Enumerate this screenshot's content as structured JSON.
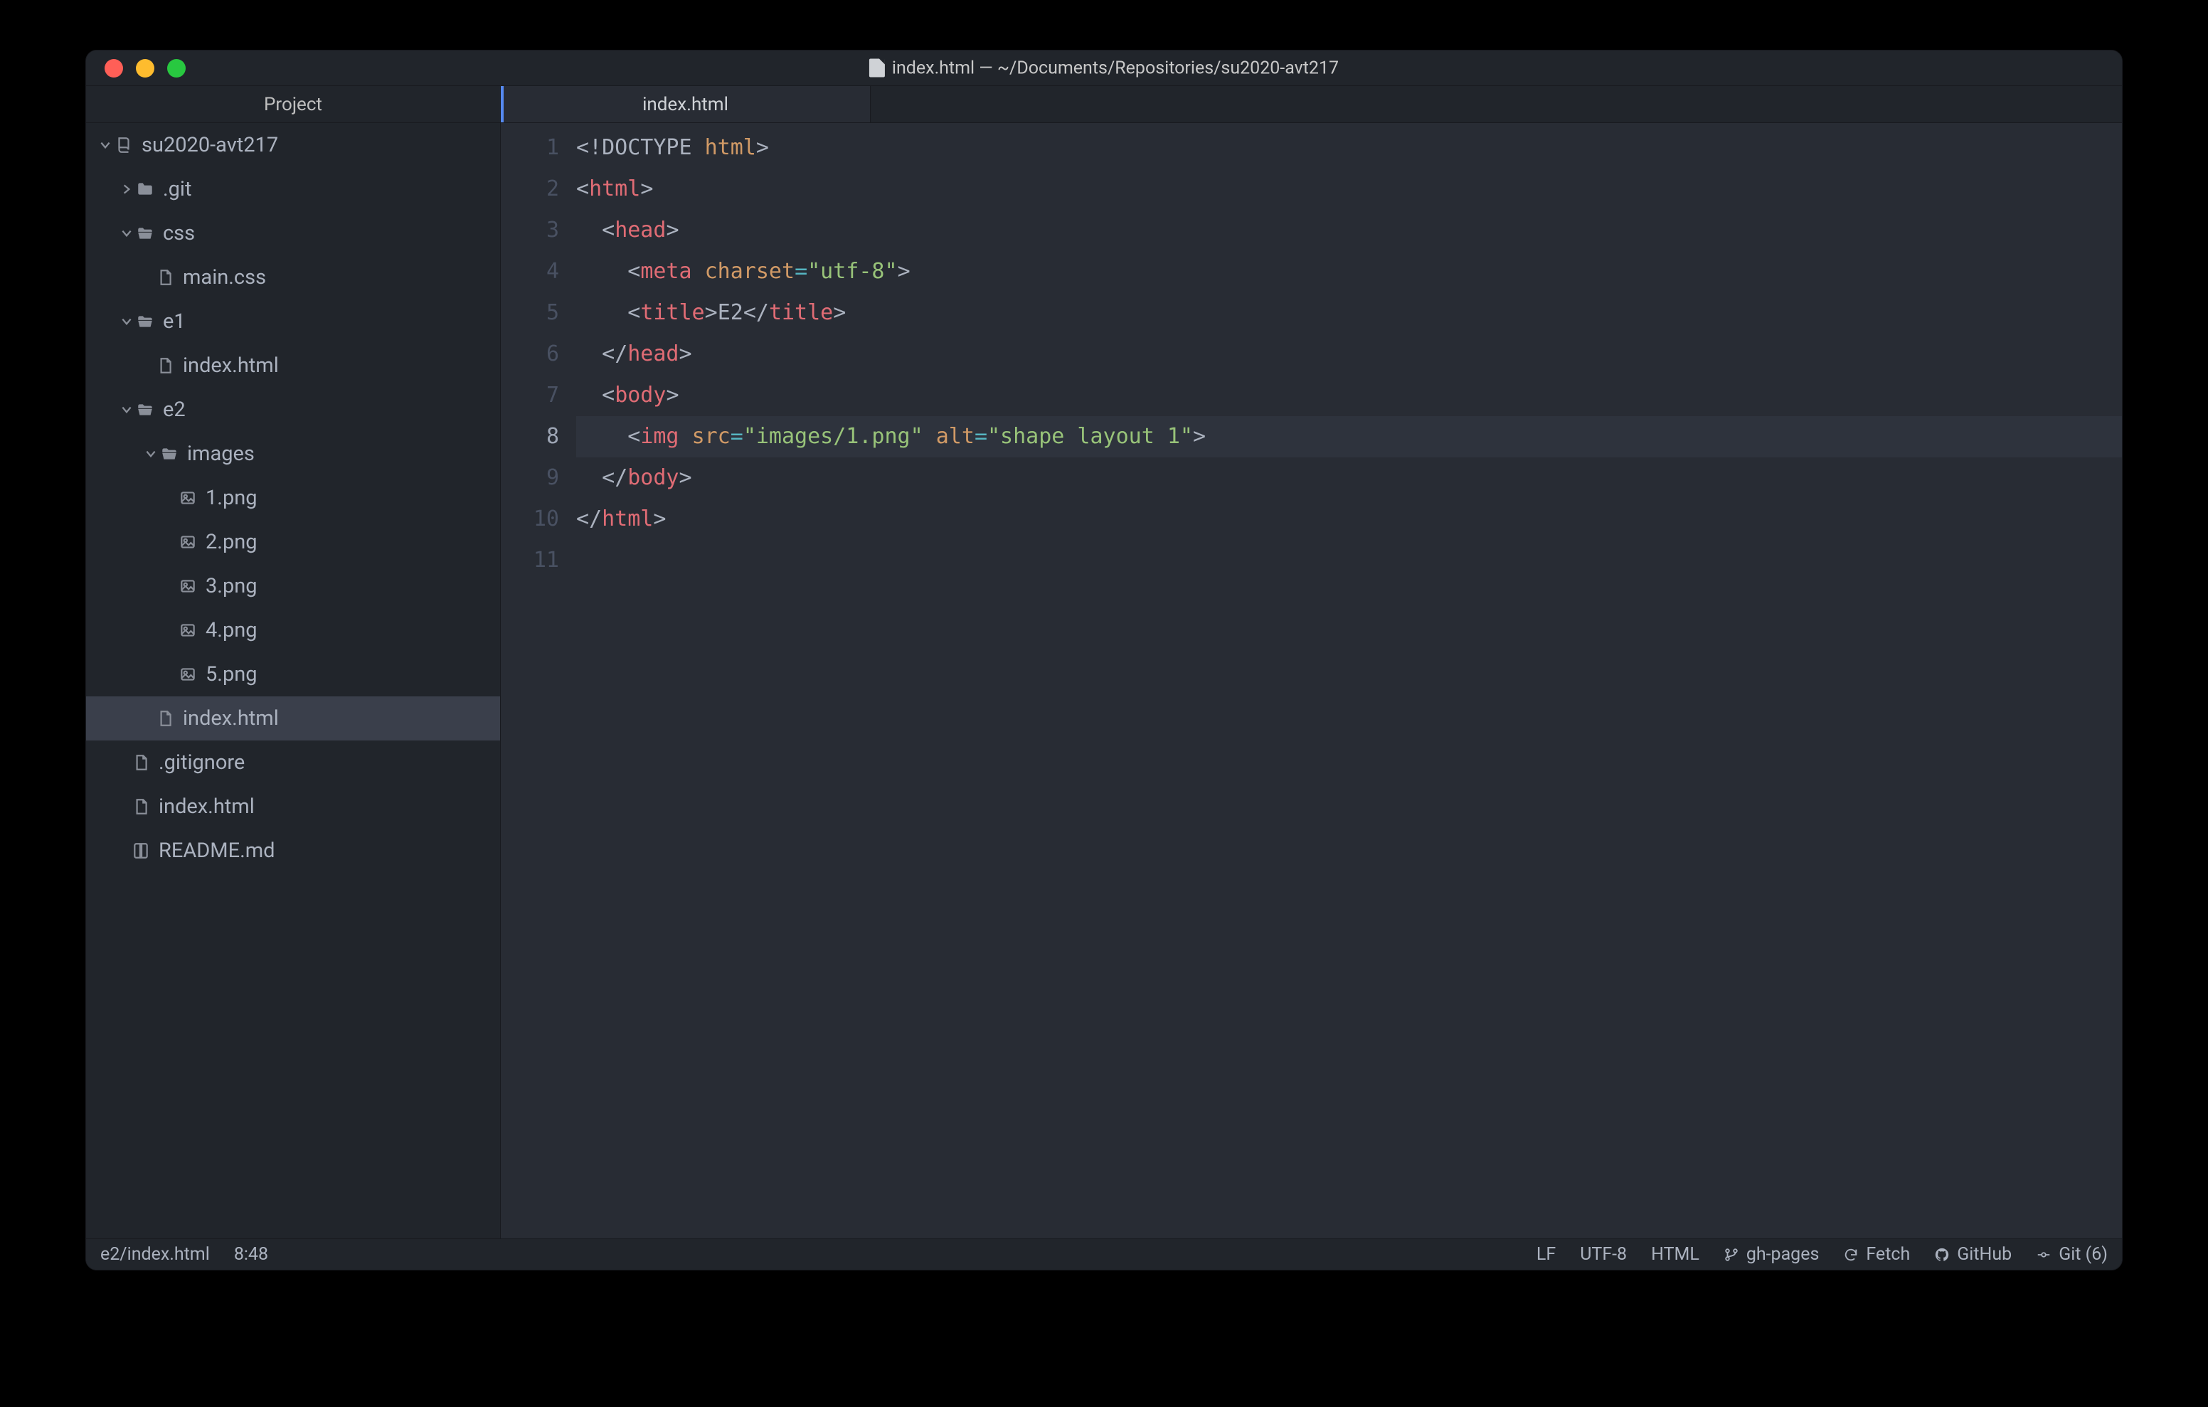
{
  "title": "index.html — ~/Documents/Repositories/su2020-avt217",
  "sidebar": {
    "tab": "Project",
    "root": "su2020-avt217",
    "items": {
      "git": ".git",
      "css": "css",
      "maincss": "main.css",
      "e1": "e1",
      "e1_index": "index.html",
      "e2": "e2",
      "images": "images",
      "img1": "1.png",
      "img2": "2.png",
      "img3": "3.png",
      "img4": "4.png",
      "img5": "5.png",
      "e2_index": "index.html",
      "gitignore": ".gitignore",
      "root_index": "index.html",
      "readme": "README.md"
    }
  },
  "tabs": {
    "active": "index.html"
  },
  "gutter": {
    "1": "1",
    "2": "2",
    "3": "3",
    "4": "4",
    "5": "5",
    "6": "6",
    "7": "7",
    "8": "8",
    "9": "9",
    "10": "10",
    "11": "11"
  },
  "code": {
    "doctype_open": "<!",
    "doctype": "DOCTYPE",
    "sp": " ",
    "attr_html": "html",
    "gt": ">",
    "lt": "<",
    "slash": "/",
    "tag_html": "html",
    "tag_head": "head",
    "tag_meta": "meta",
    "tag_title": "title",
    "tag_body": "body",
    "tag_img": "img",
    "attr_charset": "charset",
    "attr_src": "src",
    "attr_alt": "alt",
    "eq": "=",
    "val_charset": "\"utf-8\"",
    "val_src": "\"images/1.png\"",
    "val_alt": "\"shape layout 1\"",
    "title_text": "E2",
    "pad2": "  ",
    "pad4": "    ",
    "pad1": " "
  },
  "status": {
    "path": "e2/index.html",
    "cursor": "8:48",
    "eol": "LF",
    "encoding": "UTF-8",
    "grammar": "HTML",
    "branch": "gh-pages",
    "fetch": "Fetch",
    "github": "GitHub",
    "git": "Git (6)"
  }
}
